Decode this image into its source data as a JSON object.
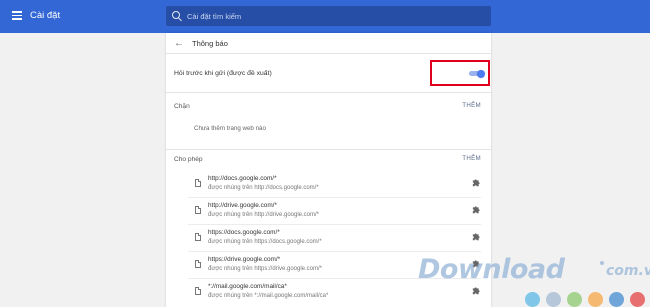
{
  "topbar": {
    "title": "Cài đặt",
    "search_placeholder": "Cài đặt tìm kiếm",
    "color": "#3367d6"
  },
  "page": {
    "title": "Thông báo",
    "back_icon": "arrow-back-icon"
  },
  "ask_before_sending": {
    "label": "Hỏi trước khi gửi (được đề xuất)",
    "enabled": true,
    "highlight_color": "#e0001b"
  },
  "block": {
    "label": "Chặn",
    "add_label": "THÊM",
    "empty_text": "Chưa thêm trang web nào"
  },
  "allow": {
    "label": "Cho phép",
    "add_label": "THÊM",
    "items": [
      {
        "url": "http://docs.google.com/*",
        "embedded": "được nhúng trên http://docs.google.com/*"
      },
      {
        "url": "http://drive.google.com/*",
        "embedded": "được nhúng trên http://drive.google.com/*"
      },
      {
        "url": "https://docs.google.com/*",
        "embedded": "được nhúng trên https://docs.google.com/*"
      },
      {
        "url": "https://drive.google.com/*",
        "embedded": "được nhúng trên https://drive.google.com/*"
      },
      {
        "url": "*://mail.google.com/mail/ca*",
        "embedded": "được nhúng trên *://mail.google.com/mail/ca*"
      }
    ]
  },
  "watermark": {
    "brand": "Download",
    "tld": "com.vn",
    "dot_colors": [
      "#7fc6e8",
      "#b5c7d9",
      "#a6d38f",
      "#f5b971",
      "#6fa5d8",
      "#e86f6f"
    ]
  }
}
